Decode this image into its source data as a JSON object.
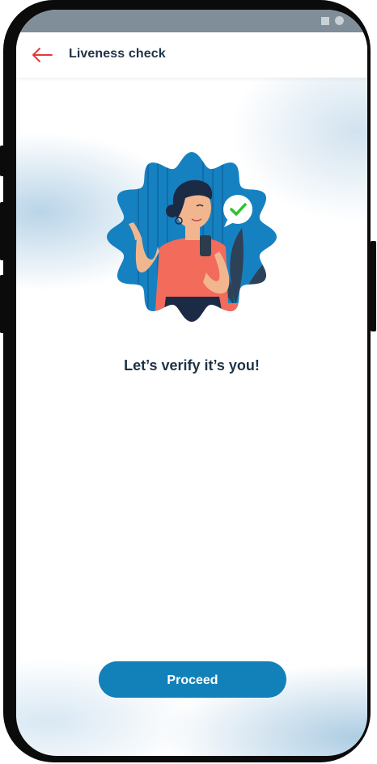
{
  "status_bar": {
    "icons": [
      "square-icon",
      "circle-icon"
    ]
  },
  "header": {
    "title": "Liveness check",
    "back_icon": "arrow-left-icon"
  },
  "illustration": {
    "name": "woman-selfie-illustration",
    "badge": "checkmark-icon"
  },
  "main": {
    "headline": "Let’s verify it’s you!"
  },
  "footer": {
    "proceed_label": "Proceed"
  },
  "colors": {
    "accent": "#1381b9",
    "back_arrow": "#e23a3a",
    "title_text": "#1f3347",
    "check": "#2ec22e"
  }
}
